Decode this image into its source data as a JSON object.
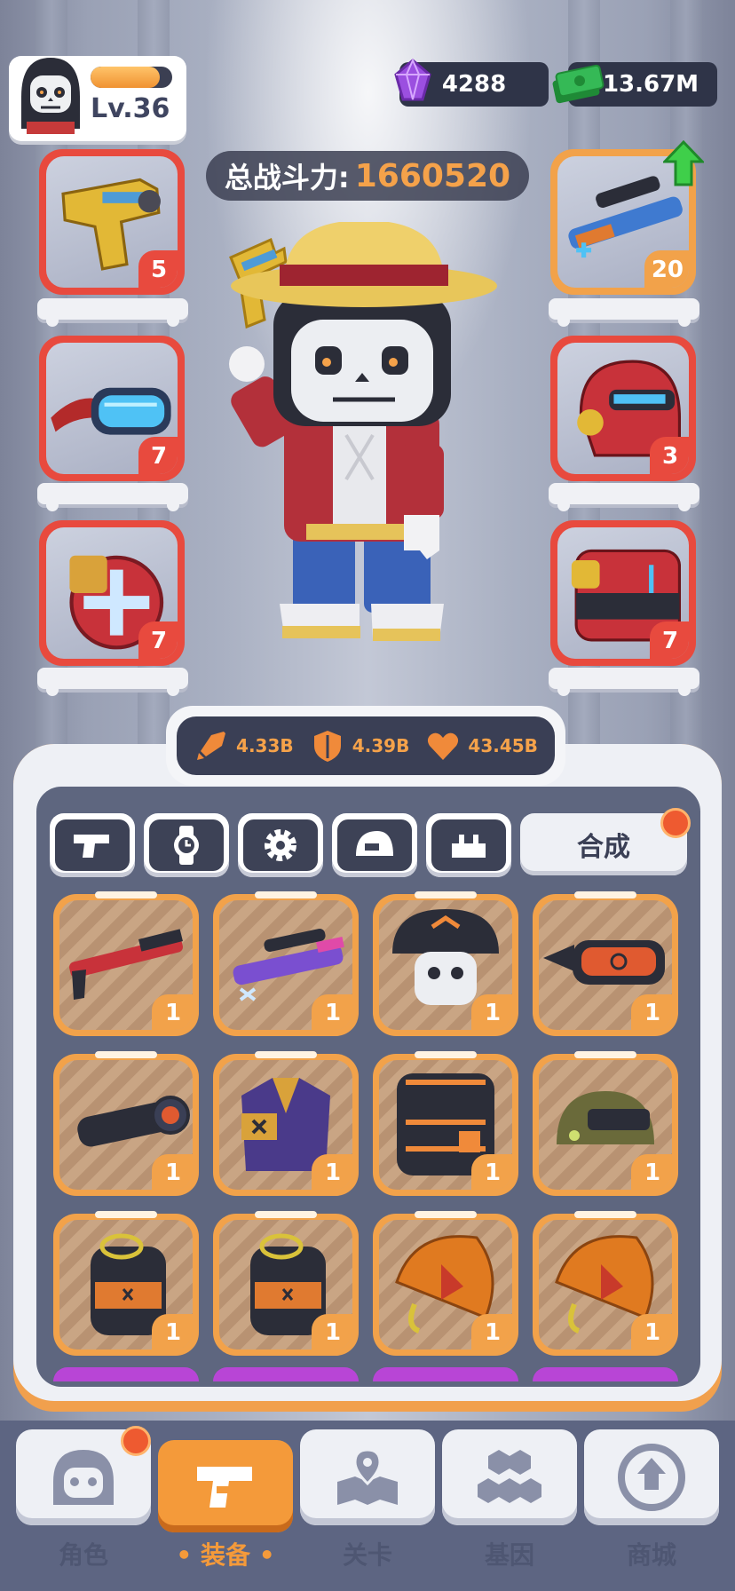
{
  "player": {
    "level": "Lv.36",
    "xp_fraction": 0.85
  },
  "currency": {
    "gems": "4288",
    "cash": "13.67M"
  },
  "power": {
    "label": "总战斗力:",
    "value": "1660520"
  },
  "left_slots": [
    {
      "icon": "gold-pistol-icon",
      "count": "5"
    },
    {
      "icon": "goggles-icon",
      "count": "7"
    },
    {
      "icon": "grenade-icon",
      "count": "7"
    }
  ],
  "right_slots": [
    {
      "icon": "blue-rifle-icon",
      "count": "20"
    },
    {
      "icon": "red-helmet-icon",
      "count": "3"
    },
    {
      "icon": "red-armor-icon",
      "count": "7"
    }
  ],
  "stats": {
    "attack": "4.33B",
    "defense": "4.39B",
    "health": "43.45B"
  },
  "tabs": [
    "gun-tab",
    "watch-tab",
    "gear-tab",
    "helmet-tab",
    "armor-tab"
  ],
  "merge_label": "合成",
  "items": [
    {
      "icon": "red-shotgun-icon",
      "count": "1"
    },
    {
      "icon": "purple-sniper-icon",
      "count": "1"
    },
    {
      "icon": "skull-cap-icon",
      "count": "1"
    },
    {
      "icon": "dark-goggles-icon",
      "count": "1"
    },
    {
      "icon": "scope-icon",
      "count": "1"
    },
    {
      "icon": "purple-suit-icon",
      "count": "1"
    },
    {
      "icon": "black-vest-icon",
      "count": "1"
    },
    {
      "icon": "green-helmet-icon",
      "count": "1"
    },
    {
      "icon": "black-grenade-icon",
      "count": "1"
    },
    {
      "icon": "black-grenade-icon",
      "count": "1"
    },
    {
      "icon": "orange-umbrella-icon",
      "count": "1"
    },
    {
      "icon": "orange-umbrella-icon",
      "count": "1"
    }
  ],
  "nav": [
    "角色",
    "装备",
    "关卡",
    "基因",
    "商城"
  ],
  "colors": {
    "accent": "#f49a3a",
    "red": "#e84a3e",
    "dark": "#3a3f55",
    "gem": "#9b4fe0",
    "cash": "#2fae4a"
  }
}
